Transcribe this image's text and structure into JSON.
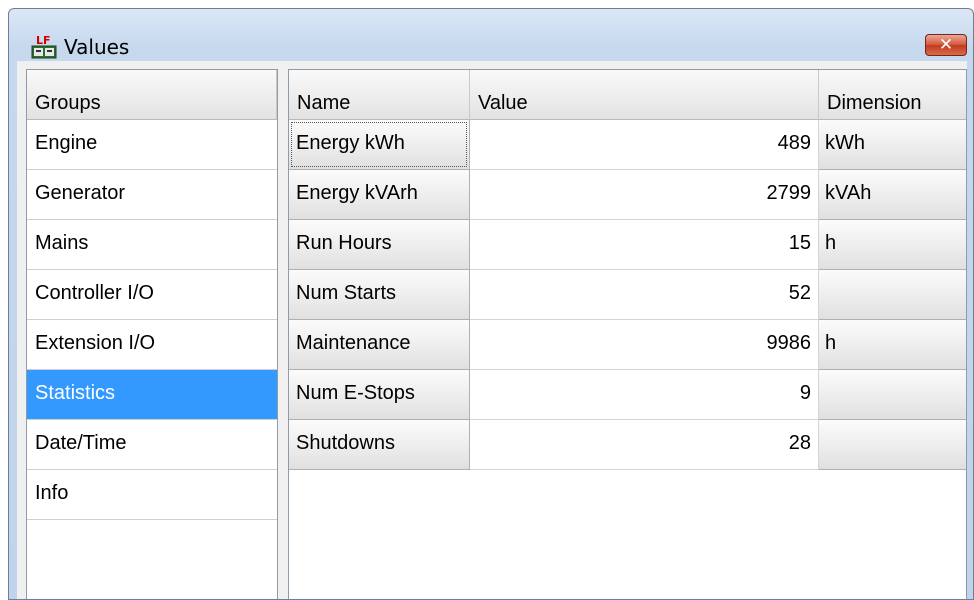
{
  "window": {
    "title": "Values",
    "app_icon": "lf-app-icon",
    "close_icon": "close-icon",
    "close_glyph": "✕"
  },
  "groups": {
    "header": "Groups",
    "items": [
      {
        "label": "Engine",
        "selected": false
      },
      {
        "label": "Generator",
        "selected": false
      },
      {
        "label": "Mains",
        "selected": false
      },
      {
        "label": "Controller I/O",
        "selected": false
      },
      {
        "label": "Extension I/O",
        "selected": false
      },
      {
        "label": "Statistics",
        "selected": true
      },
      {
        "label": "Date/Time",
        "selected": false
      },
      {
        "label": "Info",
        "selected": false
      }
    ]
  },
  "values": {
    "columns": {
      "name": "Name",
      "value": "Value",
      "dimension": "Dimension"
    },
    "rows": [
      {
        "name": "Energy kWh",
        "value": "489",
        "dimension": "kWh"
      },
      {
        "name": "Energy kVArh",
        "value": "2799",
        "dimension": "kVAh"
      },
      {
        "name": "Run Hours",
        "value": "15",
        "dimension": "h"
      },
      {
        "name": "Num Starts",
        "value": "52",
        "dimension": ""
      },
      {
        "name": "Maintenance",
        "value": "9986",
        "dimension": "h"
      },
      {
        "name": "Num E-Stops",
        "value": "9",
        "dimension": ""
      },
      {
        "name": "Shutdowns",
        "value": "28",
        "dimension": ""
      }
    ]
  },
  "colors": {
    "selection": "#3399ff",
    "close_button": "#c13b1e"
  }
}
